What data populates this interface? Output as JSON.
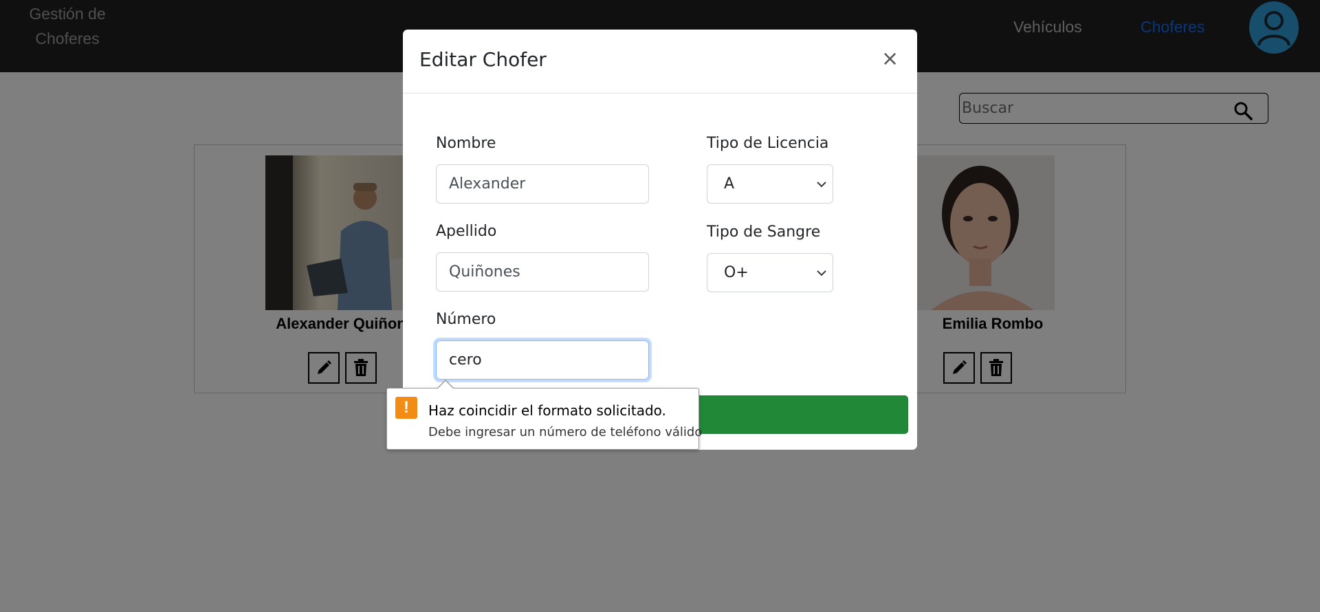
{
  "navbar": {
    "brand_line1": "Gestión de",
    "brand_line2": "Choferes",
    "links": [
      "Vehículos",
      "Choferes"
    ],
    "active_link": "Choferes",
    "avatar_icon": "user-icon"
  },
  "search": {
    "placeholder": "Buscar",
    "icon": "search-icon"
  },
  "cards": [
    {
      "name": "Alexander Quiñon",
      "photo": "driver-photo"
    },
    {
      "name": "Emilia Rombo",
      "photo": "woman-photo"
    }
  ],
  "modal": {
    "title": "Editar Chofer",
    "close_label": "×",
    "fields": {
      "nombre_label": "Nombre",
      "nombre_value": "Alexander",
      "apellido_label": "Apellido",
      "apellido_value": "Quiñones",
      "numero_label": "Número",
      "numero_value": "cero",
      "licencia_label": "Tipo de Licencia",
      "licencia_value": "A",
      "sangre_label": "Tipo de Sangre",
      "sangre_value": "O+"
    }
  },
  "validation": {
    "icon": "warning-icon",
    "icon_glyph": "!",
    "title": "Haz coincidir el formato solicitado.",
    "message": "Debe ingresar un número de teléfono válido"
  },
  "colors": {
    "navbar": "#212121",
    "active": "#0d6efd",
    "submit": "#218838",
    "warning": "#f28c14"
  }
}
